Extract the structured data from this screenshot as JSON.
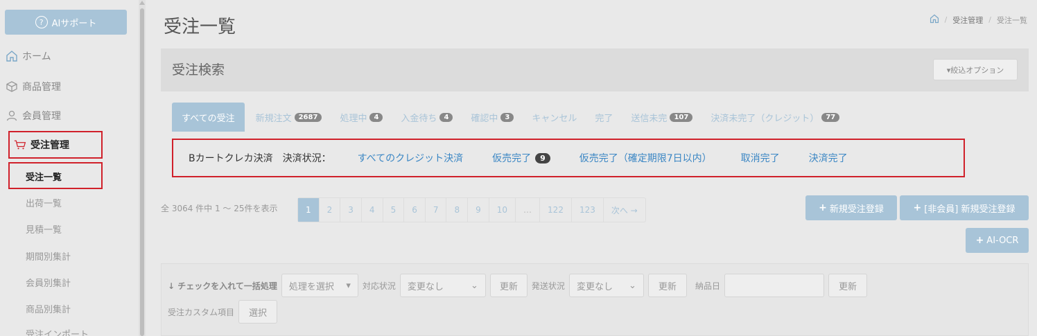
{
  "sidebar": {
    "ai_support": "AIサポート",
    "items": [
      {
        "label": "ホーム",
        "icon": "home-icon"
      },
      {
        "label": "商品管理",
        "icon": "box-icon"
      },
      {
        "label": "会員管理",
        "icon": "user-icon"
      },
      {
        "label": "受注管理",
        "icon": "cart-icon"
      }
    ],
    "subitems": [
      "受注一覧",
      "出荷一覧",
      "見積一覧",
      "期間別集計",
      "会員別集計",
      "商品別集計",
      "受注インポート"
    ]
  },
  "header": {
    "title": "受注一覧",
    "breadcrumb": [
      "受注管理",
      "受注一覧"
    ]
  },
  "search_panel": {
    "title": "受注検索",
    "filter_option": "▾絞込オプション"
  },
  "tabs": [
    {
      "label": "すべての受注",
      "badge": ""
    },
    {
      "label": "新規注文",
      "badge": "2687"
    },
    {
      "label": "処理中",
      "badge": "4"
    },
    {
      "label": "入金待ち",
      "badge": "4"
    },
    {
      "label": "確認中",
      "badge": "3"
    },
    {
      "label": "キャンセル",
      "badge": ""
    },
    {
      "label": "完了",
      "badge": ""
    },
    {
      "label": "送信未完",
      "badge": "107"
    },
    {
      "label": "決済未完了（クレジット）",
      "badge": "77"
    }
  ],
  "credit": {
    "label": "Bカートクレカ決済　決済状況：",
    "links": [
      {
        "label": "すべてのクレジット決済",
        "badge": ""
      },
      {
        "label": "仮売完了",
        "badge": "9"
      },
      {
        "label": "仮売完了（確定期限7日以内）",
        "badge": ""
      },
      {
        "label": "取消完了",
        "badge": ""
      },
      {
        "label": "決済完了",
        "badge": ""
      }
    ]
  },
  "list": {
    "count_text": "全 3064 件中 1 ～ 25件を表示",
    "pages": [
      "1",
      "2",
      "3",
      "4",
      "5",
      "6",
      "7",
      "8",
      "9",
      "10",
      "…",
      "122",
      "123",
      "次へ →"
    ],
    "new_order": "新規受注登録",
    "guest_order": "[非会員] 新規受注登録",
    "ai_ocr": "AI-OCR"
  },
  "bulk": {
    "title": "チェックを入れて一括処理",
    "process_select": "処理を選択",
    "status_label": "対応状況",
    "status_value": "変更なし",
    "update": "更新",
    "ship_label": "発送状況",
    "ship_value": "変更なし",
    "delivery_label": "納品日",
    "delivery_value": "",
    "custom_label": "受注カスタム項目",
    "select": "選択"
  }
}
